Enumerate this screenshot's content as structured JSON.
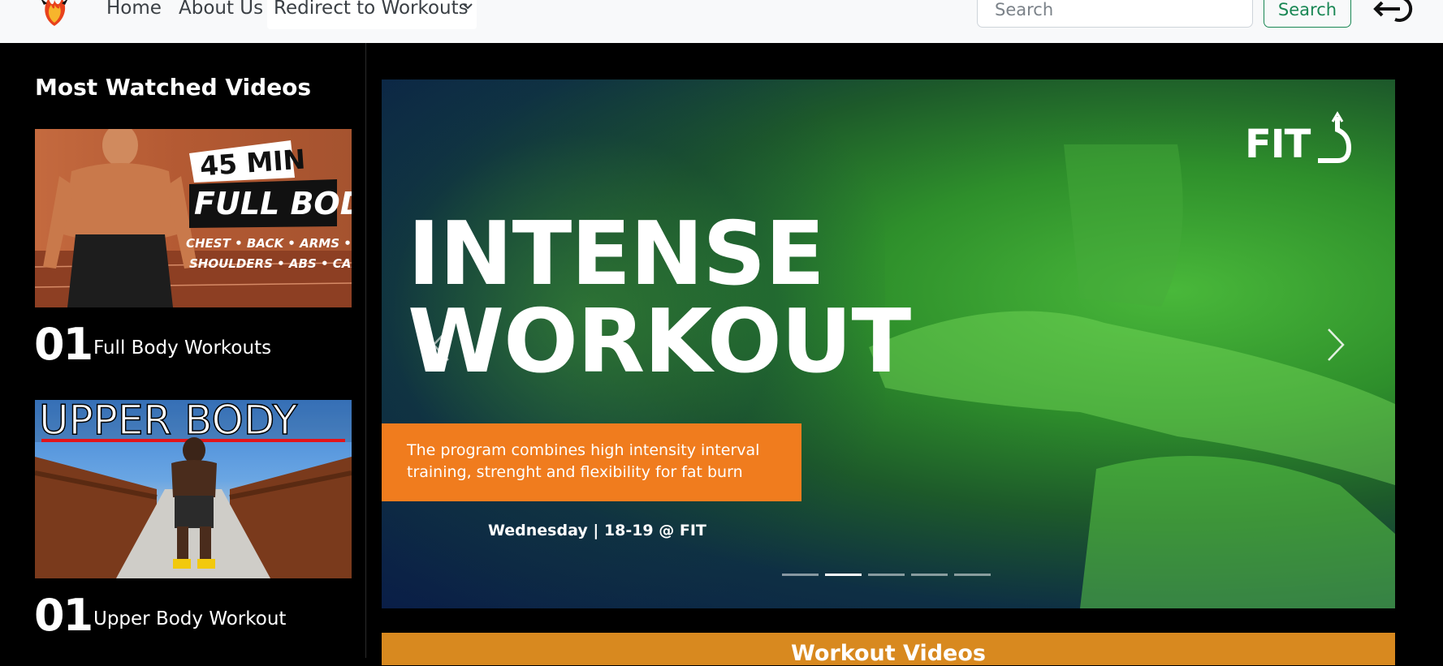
{
  "navbar": {
    "home_label": "Home",
    "about_label": "About Us",
    "dropdown_label": "Redirect to Workouts",
    "search_placeholder": "Search",
    "search_button_label": "Search"
  },
  "sidebar": {
    "title": "Most Watched Videos",
    "videos": [
      {
        "number": "01",
        "label": "Full Body Workouts",
        "thumb_text": [
          "45 MIN",
          "FULL BODY",
          "CHEST • BACK • ARMS • LEGS",
          "SHOULDERS • ABS • CARDIO"
        ]
      },
      {
        "number": "01",
        "label": "Upper Body Workout",
        "thumb_text": [
          "UPPER BODY"
        ]
      }
    ]
  },
  "carousel": {
    "title_line1": "INTENSE",
    "title_line2": "WORKOUT",
    "description": "The program combines high intensity interval training, strenght and flexibility for fat burn",
    "schedule": "Wednesday | 18-19 @ FIT",
    "brand": "FIT",
    "indicators": 5,
    "active_index": 1
  },
  "section": {
    "workout_videos_label": "Workout Videos"
  },
  "colors": {
    "navbar_bg": "#f8f9fa",
    "search_green": "#198754",
    "hero_orange": "#f07c1e",
    "section_bar": "#d8891f",
    "hero_green": "#49b83a",
    "hero_navy": "#0a1e47"
  },
  "icons": {
    "logo": "flame-bull-logo-icon",
    "dropdown": "chevron-down-icon",
    "logout": "logout-icon",
    "prev": "chevron-left-icon",
    "next": "chevron-right-icon"
  }
}
